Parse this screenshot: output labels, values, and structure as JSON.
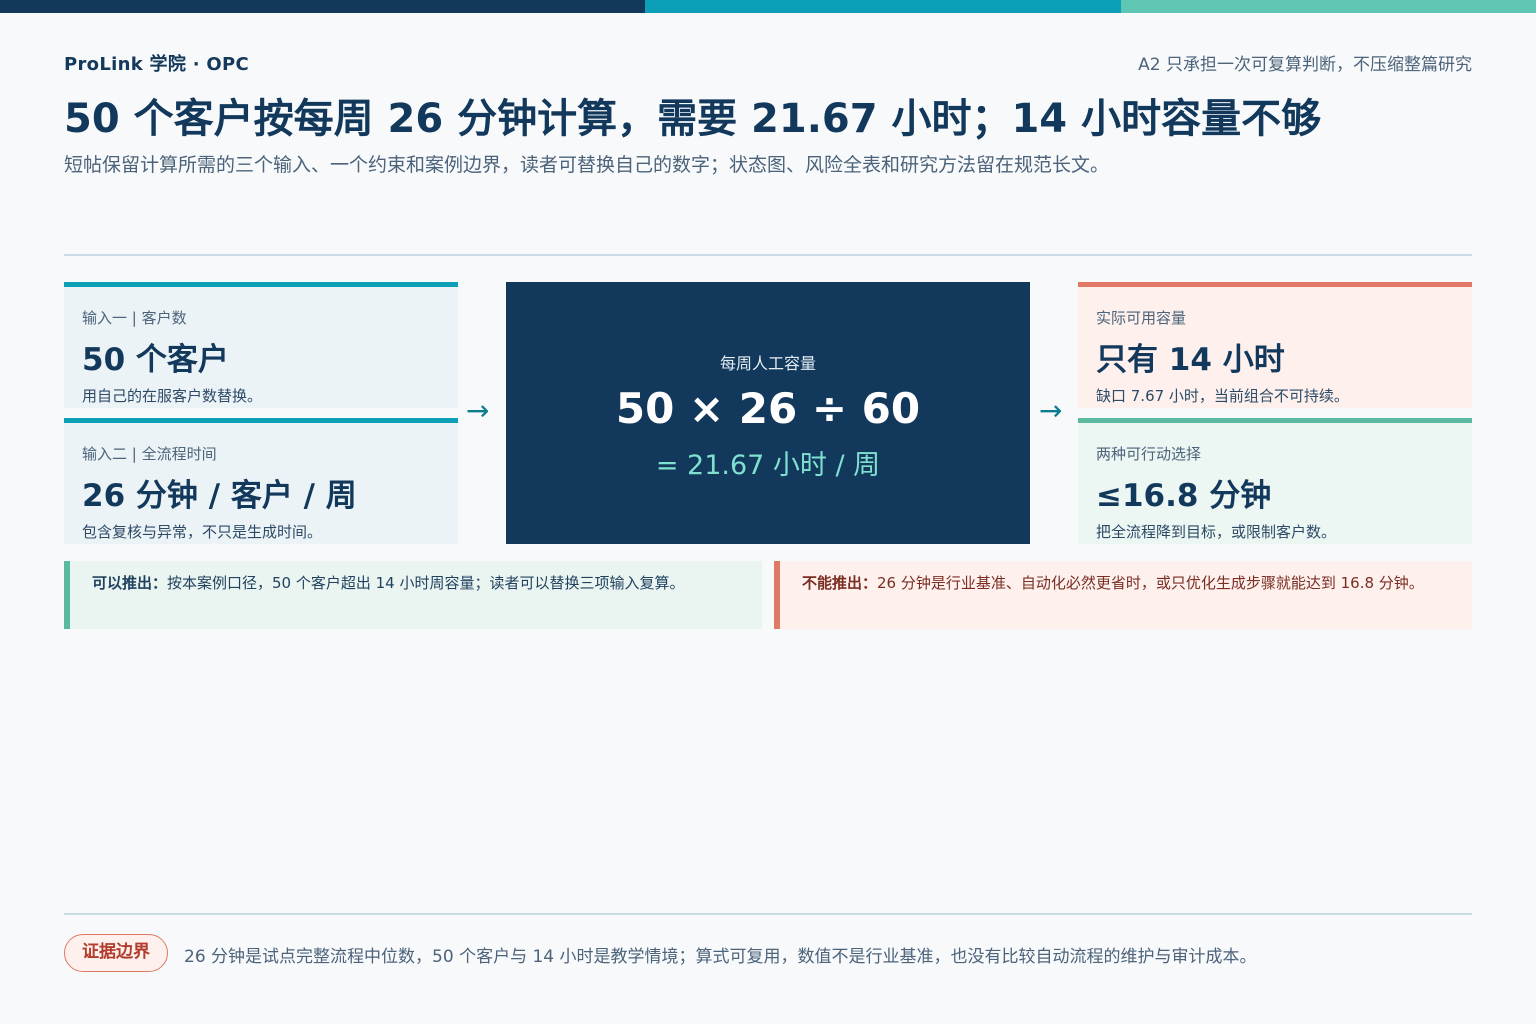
{
  "header": {
    "brand": "ProLink 学院 · OPC",
    "note": "A2 只承担一次可复算判断，不压缩整篇研究",
    "title": "50 个客户按每周 26 分钟计算，需要 21.67 小时；14 小时容量不够",
    "subtitle": "短帖保留计算所需的三个输入、一个约束和案例边界，读者可替换自己的数字；状态图、风险全表和研究方法留在规范长文。"
  },
  "inputs": [
    {
      "label": "输入一 | 客户数",
      "value": "50 个客户",
      "desc": "用自己的在服客户数替换。"
    },
    {
      "label": "输入二 | 全流程时间",
      "value": "26 分钟 / 客户 / 周",
      "desc": "包含复核与异常，不只是生成时间。"
    }
  ],
  "calc": {
    "label": "每周人工容量",
    "formula": "50 × 26 ÷ 60",
    "result": "= 21.67 小时 / 周"
  },
  "outputs": [
    {
      "label": "实际可用容量",
      "value": "只有 14 小时",
      "desc": "缺口 7.67 小时，当前组合不可持续。"
    },
    {
      "label": "两种可行动选择",
      "value": "≤16.8 分钟",
      "desc": "把全流程降到目标，或限制客户数。"
    }
  ],
  "arrows": {
    "glyph": "→"
  },
  "callouts": {
    "can_label": "可以推出：",
    "can_text": "按本案例口径，50 个客户超出 14 小时周容量；读者可以替换三项输入复算。",
    "cannot_label": "不能推出：",
    "cannot_text": "26 分钟是行业基准、自动化必然更省时，或只优化生成步骤就能达到 16.8 分钟。"
  },
  "footer": {
    "badge": "证据边界",
    "text": "26 分钟是试点完整流程中位数，50 个客户与 14 小时是教学情境；算式可复用，数值不是行业基准，也没有比较自动流程的维护与审计成本。"
  },
  "colors": {
    "navy": "#12385c",
    "teal": "#0e9fb8",
    "mint": "#5fc6b3",
    "coral": "#e07a67",
    "green": "#5ab99f"
  }
}
